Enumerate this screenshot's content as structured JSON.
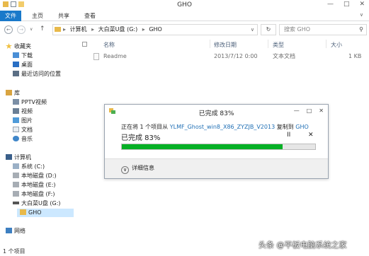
{
  "window": {
    "title": "GHO",
    "controls": [
      "—",
      "□",
      "✕"
    ]
  },
  "ribbon": {
    "tabs": [
      "文件",
      "主页",
      "共享",
      "查看"
    ],
    "expand": "∨"
  },
  "nav": {
    "back": "←",
    "forward": "→",
    "dropdown": "∨",
    "up": "↑",
    "address": [
      "计算机",
      "大白菜U盘 (G:)",
      "GHO"
    ],
    "separator": "▸",
    "refresh": "↻",
    "search_placeholder": "搜索 GHO",
    "search_icon": "⚲"
  },
  "sidebar": {
    "favorites_header": "收藏夹",
    "favorites": [
      "下载",
      "桌面",
      "最近访问的位置"
    ],
    "libraries_header": "库",
    "libraries": [
      "PPTV视频",
      "视频",
      "图片",
      "文档",
      "音乐"
    ],
    "computer_header": "计算机",
    "drives": [
      "系统 (C:)",
      "本地磁盘 (D:)",
      "本地磁盘 (E:)",
      "本地磁盘 (F:)",
      "大白菜U盘 (G:)",
      "GHO"
    ],
    "network_header": "网络"
  },
  "columns": [
    "名称",
    "修改日期",
    "类型",
    "大小"
  ],
  "files": [
    {
      "name": "Readme",
      "modified": "2013/7/12 0:00",
      "type": "文本文档",
      "size": "1 KB"
    }
  ],
  "status": {
    "count": "1 个项目"
  },
  "dialog": {
    "title": "已完成 83%",
    "copy_prefix": "正在将 1 个项目从",
    "source": "YLMF_Ghost_win8_X86_ZYZJB_V2013",
    "copy_mid": "复制到",
    "destination": "GHO",
    "progress_text": "已完成 83%",
    "progress": 0.83,
    "pause": "II",
    "cancel": "✕",
    "details": "详细信息",
    "controls": [
      "—",
      "□",
      "✕"
    ]
  },
  "watermark": "头条 @平板电脑系统之家",
  "colors": {
    "accent": "#1979ca",
    "progress": "#06b025",
    "link": "#1f6fb5"
  }
}
